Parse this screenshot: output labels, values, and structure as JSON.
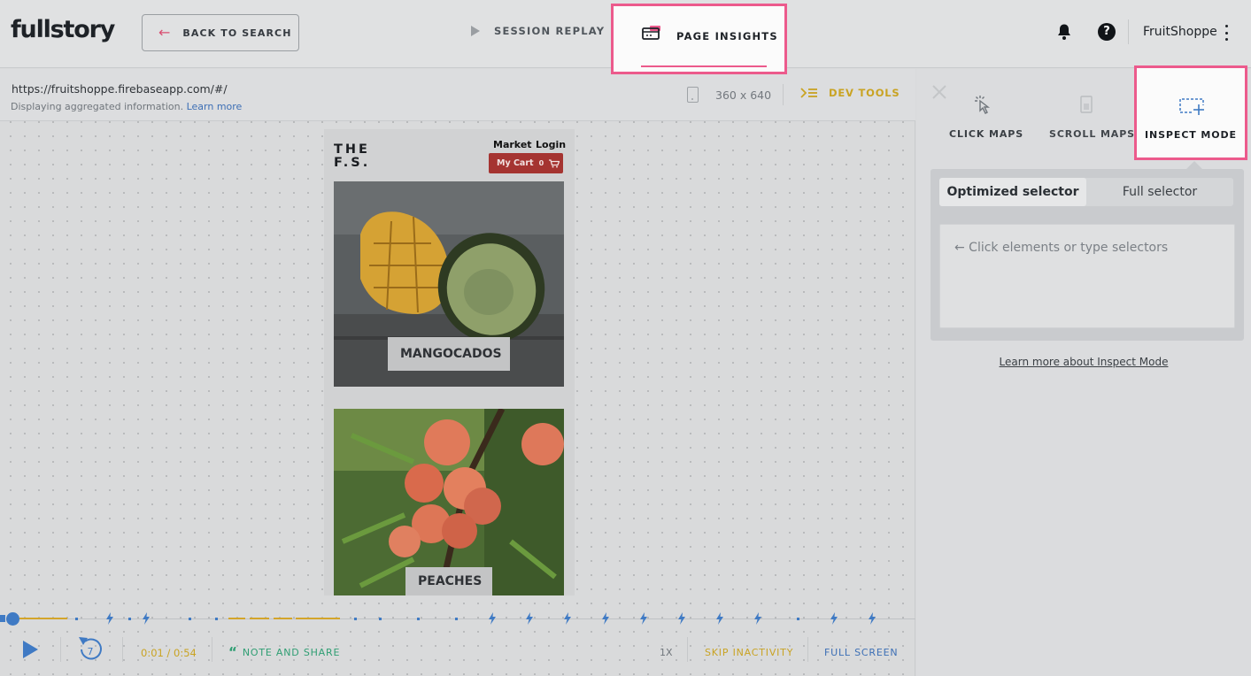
{
  "header": {
    "logo": "fullstory",
    "back_label": "BACK TO SEARCH",
    "tabs": [
      {
        "label": "SESSION REPLAY",
        "active": false
      },
      {
        "label": "PAGE INSIGHTS",
        "active": true
      }
    ],
    "help_label": "?",
    "account": "FruitShoppe"
  },
  "urlbar": {
    "url": "https://fruitshoppe.firebaseapp.com/#/",
    "info": "Displaying aggregated information.",
    "learn_more": "Learn more",
    "dimensions": "360 x 640",
    "dev_tools": "DEV TOOLS"
  },
  "preview": {
    "brand_line1": "THE",
    "brand_line2": "F.S.",
    "nav_market": "Market",
    "nav_login": "Login",
    "cart_label": "My Cart",
    "cart_count": "0",
    "products": [
      {
        "name": "MANGOCADOS"
      },
      {
        "name": "PEACHES"
      }
    ]
  },
  "playback": {
    "time": "0:01 / 0:54",
    "rewind_seconds": "7",
    "note_label": "NOTE AND SHARE",
    "speed": "1X",
    "skip_label": "SKIP INACTIVITY",
    "fullscreen_label": "FULL SCREEN"
  },
  "panel": {
    "modes": [
      {
        "label": "CLICK MAPS"
      },
      {
        "label": "SCROLL MAPS"
      },
      {
        "label": "INSPECT MODE",
        "active": true
      }
    ],
    "selector_tabs": [
      "Optimized selector",
      "Full selector"
    ],
    "selector_placeholder": "← Click elements or type selectors",
    "learn_more": "Learn more about Inspect Mode"
  },
  "colors": {
    "highlight": "#ec5a8c",
    "accent_blue": "#3f7ac4",
    "accent_gold": "#c9a323",
    "accent_green": "#2f9e73",
    "cart_red": "#a53431"
  }
}
